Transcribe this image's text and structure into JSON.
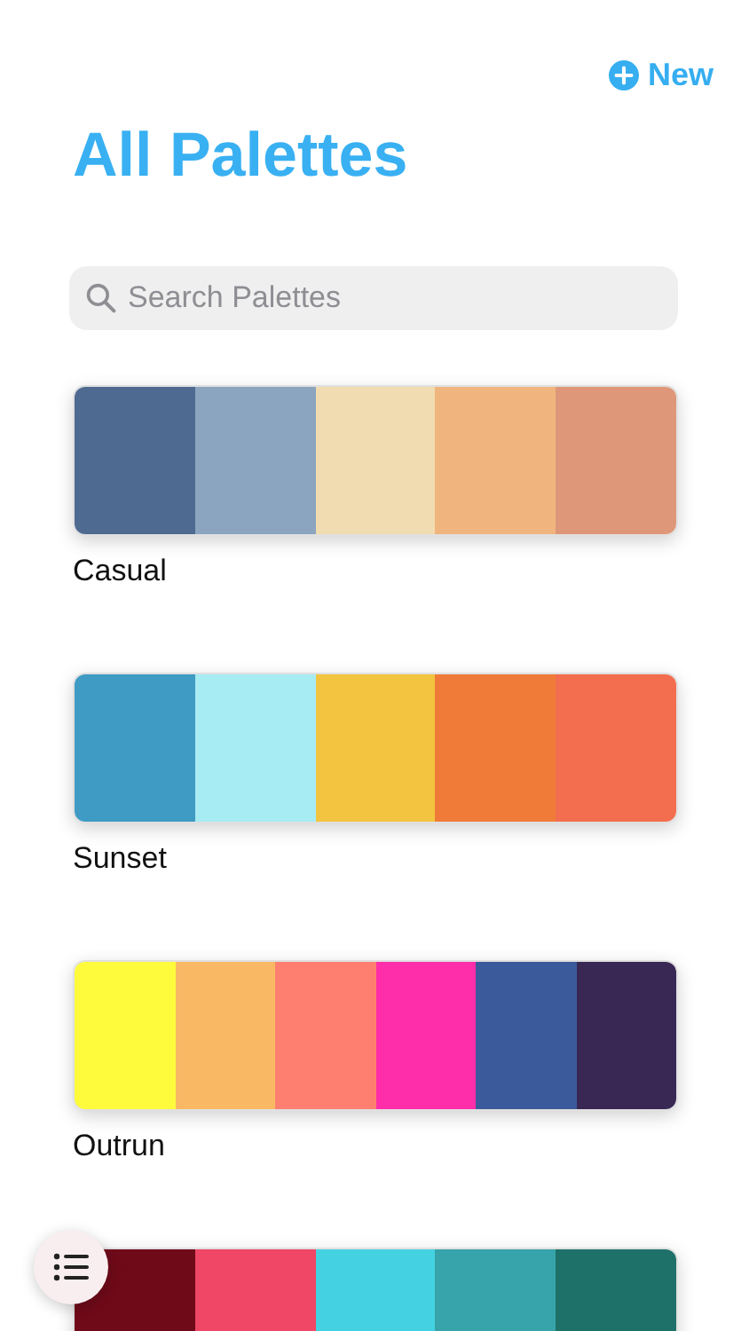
{
  "header": {
    "new_button": "New",
    "title": "All Palettes"
  },
  "search": {
    "placeholder": "Search Palettes"
  },
  "palettes": [
    {
      "name": "Casual",
      "swatches": [
        {
          "color": "#4f6a91"
        },
        {
          "color": "#8ba5c0"
        },
        {
          "color": "#f0dcb0"
        },
        {
          "color": "#f0b57f"
        },
        {
          "color": "#de9779"
        }
      ]
    },
    {
      "name": "Sunset",
      "swatches": [
        {
          "color": "#3f9bc4"
        },
        {
          "color": "#a7ebf3"
        },
        {
          "color": "#f2c43f"
        },
        {
          "color": "#f07b39"
        },
        {
          "color": "#f26e4e"
        }
      ]
    },
    {
      "name": "Outrun",
      "swatches": [
        {
          "color": "#fefb3c"
        },
        {
          "color": "#f9b964"
        },
        {
          "color": "#fe7f6f"
        },
        {
          "color": "#fe2eaa"
        },
        {
          "color": "#3b5a9b"
        },
        {
          "color": "#392754"
        }
      ]
    },
    {
      "swatches": [
        {
          "color": "#6f0a19"
        },
        {
          "color": "#ef4765"
        },
        {
          "color": "#44d2e2"
        },
        {
          "color": "#36a4aa"
        },
        {
          "color": "#1e7169"
        }
      ]
    }
  ]
}
